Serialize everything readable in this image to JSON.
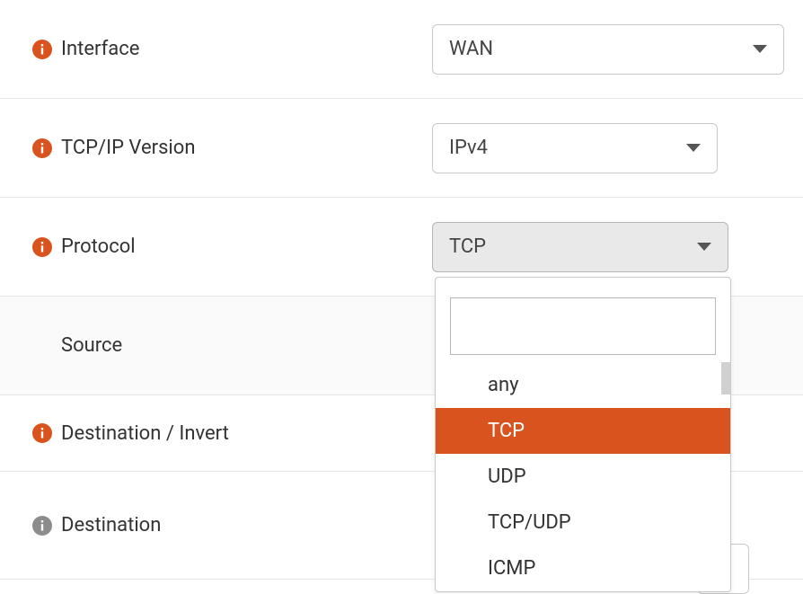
{
  "colors": {
    "accent": "#d9531e"
  },
  "rows": {
    "interface": {
      "label": "Interface",
      "value": "WAN"
    },
    "version": {
      "label": "TCP/IP Version",
      "value": "IPv4"
    },
    "protocol": {
      "label": "Protocol",
      "value": "TCP"
    },
    "source": {
      "label": "Source"
    },
    "destinvert": {
      "label": "Destination / Invert"
    },
    "destination": {
      "label": "Destination"
    }
  },
  "protocol_dropdown": {
    "search_placeholder": "",
    "options": [
      "any",
      "TCP",
      "UDP",
      "TCP/UDP",
      "ICMP"
    ],
    "selected": "TCP"
  }
}
